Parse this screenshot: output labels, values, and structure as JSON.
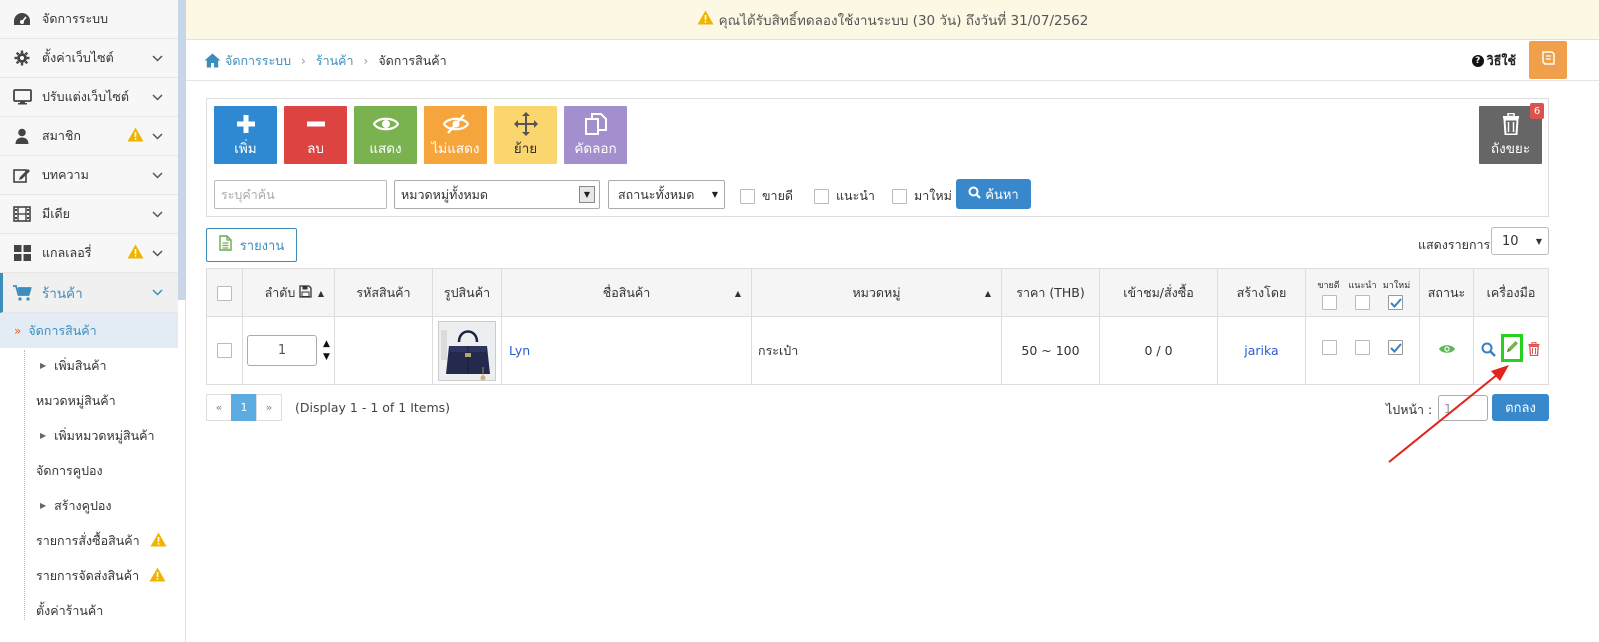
{
  "sidebar": {
    "items": [
      {
        "label": "จัดการระบบ",
        "icon": "dashboard-icon"
      },
      {
        "label": "ตั้งค่าเว็บไซต์",
        "icon": "gear-icon"
      },
      {
        "label": "ปรับแต่งเว็บไซต์",
        "icon": "monitor-icon"
      },
      {
        "label": "สมาชิก",
        "icon": "user-icon"
      },
      {
        "label": "บทความ",
        "icon": "edit-icon"
      },
      {
        "label": "มีเดีย",
        "icon": "film-icon"
      },
      {
        "label": "แกลเลอรี่",
        "icon": "grid-icon"
      },
      {
        "label": "ร้านค้า",
        "icon": "cart-icon"
      }
    ],
    "sub_items": [
      {
        "label": "จัดการสินค้า"
      },
      {
        "label": "เพิ่มสินค้า"
      },
      {
        "label": "หมวดหมู่สินค้า"
      },
      {
        "label": "เพิ่มหมวดหมู่สินค้า"
      },
      {
        "label": "จัดการคูปอง"
      },
      {
        "label": "สร้างคูปอง"
      },
      {
        "label": "รายการสั่งซื้อสินค้า"
      },
      {
        "label": "รายการจัดส่งสินค้า"
      },
      {
        "label": "ตั้งค่าร้านค้า"
      }
    ]
  },
  "notice": {
    "text": "คุณได้รับสิทธิ์ทดลองใช้งานระบบ (30 วัน) ถึงวันที่ 31/07/2562"
  },
  "breadcrumb": {
    "home": "จัดการระบบ",
    "shop": "ร้านค้า",
    "current": "จัดการสินค้า"
  },
  "help": {
    "label": "วิธีใช้"
  },
  "toolbar": {
    "add": "เพิ่ม",
    "delete": "ลบ",
    "show": "แสดง",
    "hide": "ไม่แสดง",
    "move": "ย้าย",
    "copy": "คัดลอก",
    "trash": "ถังขยะ",
    "trash_count": "6"
  },
  "filters": {
    "search_placeholder": "ระบุคำค้น",
    "category": "หมวดหมู่ทั้งหมด",
    "status": "สถานะทั้งหมด",
    "bestseller": "ขายดี",
    "recommended": "แนะนำ",
    "new_arrival": "มาใหม่",
    "search_button": "ค้นหา"
  },
  "report": {
    "label": "รายงาน"
  },
  "per_page": {
    "label": "แสดงรายการ",
    "value": "10"
  },
  "table": {
    "headers": {
      "order": "ลำดับ",
      "code": "รหัสสินค้า",
      "image": "รูปสินค้า",
      "name": "ชื่อสินค้า",
      "category": "หมวดหมู่",
      "price": "ราคา (THB)",
      "views": "เข้าชม/สั่งซื้อ",
      "created_by": "สร้างโดย",
      "flag_bestseller": "ขายดี",
      "flag_recommended": "แนะนำ",
      "flag_new": "มาใหม่",
      "status": "สถานะ",
      "tools": "เครื่องมือ"
    },
    "rows": [
      {
        "order": "1",
        "code": "",
        "name": "Lyn",
        "category": "กระเป๋า",
        "price": "50 ~ 100",
        "views": "0 / 0",
        "created_by": "jarika"
      }
    ]
  },
  "pagination": {
    "prev": "«",
    "page": "1",
    "next": "»",
    "display": "(Display 1 - 1 of 1 Items)",
    "goto_label": "ไปหน้า :",
    "goto_value": "1",
    "ok": "ตกลง"
  },
  "colors": {
    "accent": "#3c8dbc",
    "add": "#2f88d2",
    "delete": "#dd4341",
    "show": "#7ab24f",
    "hide": "#f6a43c",
    "move": "#fbd56e",
    "copy": "#a38fcd",
    "trash": "#666666",
    "highlight": "#27d11d",
    "annotation_arrow": "#e3231e"
  }
}
